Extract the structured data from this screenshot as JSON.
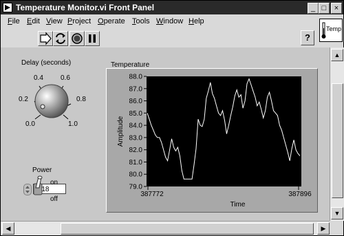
{
  "window": {
    "title": "Temperature Monitor.vi Front Panel",
    "controls": {
      "minimize": "_",
      "maximize": "□",
      "close": "×"
    }
  },
  "menu": [
    {
      "label": "File",
      "key": "F",
      "rest": "ile"
    },
    {
      "label": "Edit",
      "key": "E",
      "rest": "dit"
    },
    {
      "label": "View",
      "key": "V",
      "rest": "iew"
    },
    {
      "label": "Project",
      "key": "P",
      "rest": "roject"
    },
    {
      "label": "Operate",
      "key": "O",
      "rest": "perate"
    },
    {
      "label": "Tools",
      "key": "T",
      "rest": "ools"
    },
    {
      "label": "Window",
      "key": "W",
      "rest": "indow"
    },
    {
      "label": "Help",
      "key": "H",
      "rest": "elp"
    }
  ],
  "toolbar": {
    "buttons": [
      "run-icon",
      "run-continuously-icon",
      "abort-icon",
      "pause-icon"
    ],
    "help_label": "?",
    "vi_icon_text": "Temp"
  },
  "knob": {
    "label": "Delay (seconds)",
    "ticks": [
      "0.0",
      "0.2",
      "0.4",
      "0.6",
      "0.8",
      "1.0"
    ],
    "min": 0,
    "max": 1,
    "value_text": "0.18",
    "value": 0.18
  },
  "power": {
    "label": "Power",
    "on_label": "on",
    "off_label": "off",
    "state": "on"
  },
  "graph": {
    "label": "Temperature",
    "background": "#000000",
    "line_color": "#ffffff"
  },
  "chart_data": {
    "type": "line",
    "title": "Temperature",
    "xlabel": "Time",
    "ylabel": "Amplitude",
    "xlim": [
      387772,
      387896
    ],
    "ylim": [
      79.0,
      88.0
    ],
    "x_ticks": [
      "387772",
      "387896"
    ],
    "y_ticks": [
      "79.0",
      "80.0",
      "81.0",
      "82.0",
      "83.0",
      "84.0",
      "85.0",
      "86.0",
      "87.0",
      "88.0"
    ],
    "grid": false,
    "series": [
      {
        "values": [
          85.0,
          84.5,
          84.0,
          83.6,
          83.2,
          83.0,
          83.0,
          82.6,
          82.0,
          81.4,
          81.1,
          82.0,
          82.9,
          82.2,
          81.9,
          82.2,
          81.5,
          80.3,
          79.6,
          79.6,
          79.6,
          79.6,
          79.6,
          80.8,
          82.1,
          84.5,
          84.0,
          83.9,
          84.5,
          86.2,
          86.8,
          87.5,
          86.6,
          86.2,
          85.6,
          85.0,
          84.8,
          85.2,
          84.4,
          83.3,
          84.0,
          84.8,
          85.5,
          86.4,
          86.9,
          86.3,
          86.5,
          85.4,
          86.0,
          87.4,
          87.8,
          87.3,
          86.8,
          86.3,
          85.6,
          85.9,
          85.3,
          84.6,
          85.2,
          86.3,
          86.7,
          86.0,
          85.2,
          85.0,
          84.8,
          84.0,
          83.6,
          83.0,
          82.4,
          81.8,
          81.1,
          82.1,
          82.8,
          82.0,
          81.7,
          81.5
        ]
      }
    ]
  }
}
